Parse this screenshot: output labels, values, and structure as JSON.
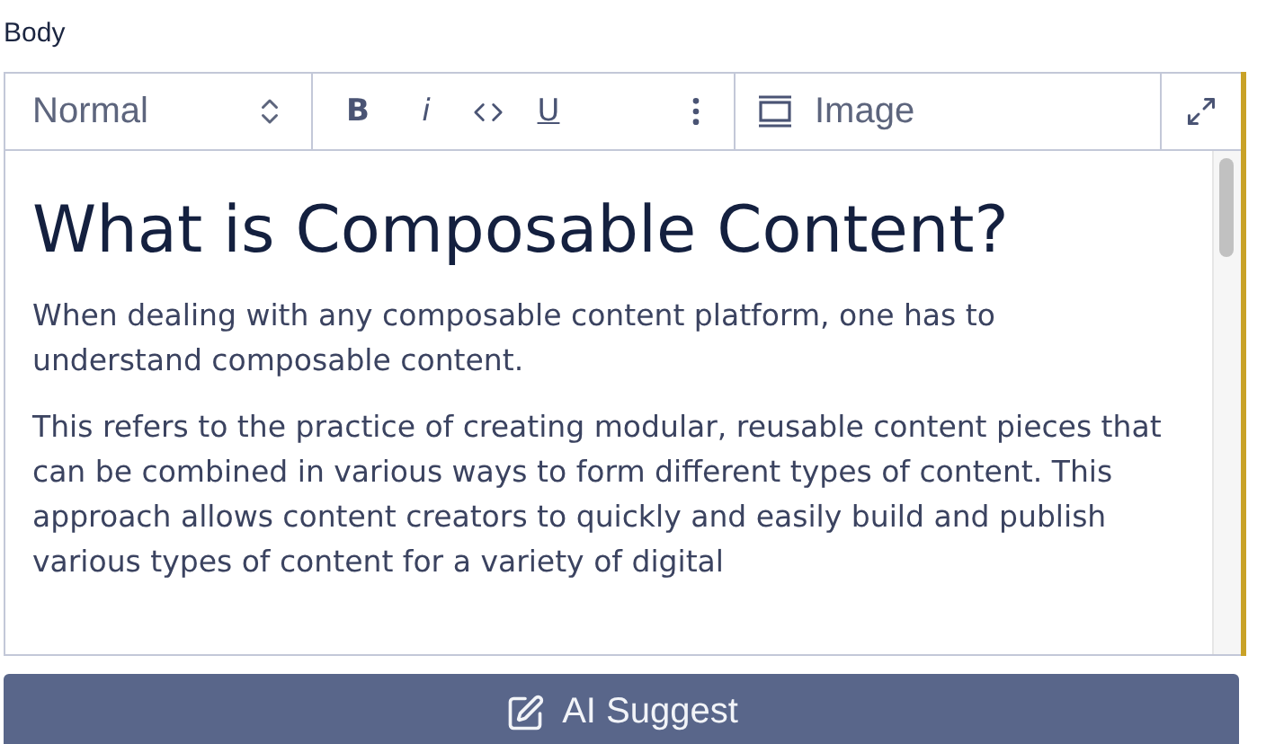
{
  "field_label": "Body",
  "toolbar": {
    "block_style": "Normal",
    "format_buttons": [
      {
        "kind": "bold",
        "label": "B"
      },
      {
        "kind": "italic",
        "label": "i"
      },
      {
        "kind": "code"
      },
      {
        "kind": "underline",
        "label": "U"
      },
      {
        "kind": "more"
      }
    ],
    "insert_image": "Image"
  },
  "content": {
    "heading": "What is Composable Content?",
    "paragraphs": [
      "When dealing with any composable content platform, one has to understand composable content.",
      "This refers to the practice of creating modular, reusable content pieces that can be combined in various ways to form different types of content. This approach allows content creators to quickly and easily build and publish various types of content for a variety of digital"
    ]
  },
  "action_button": "AI Suggest"
}
